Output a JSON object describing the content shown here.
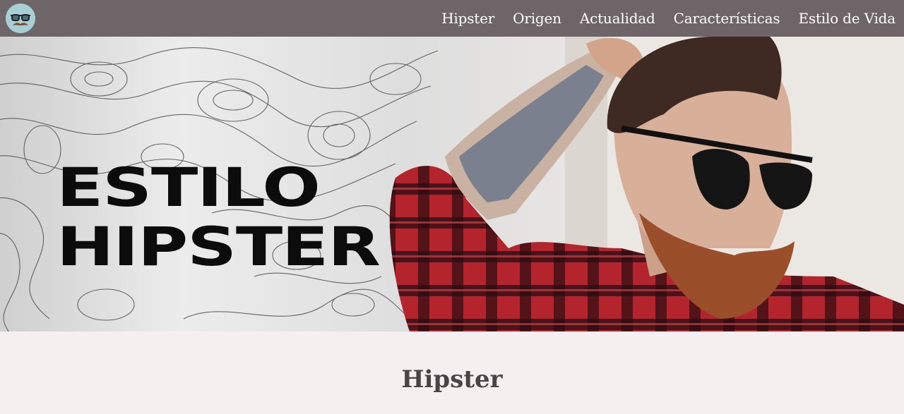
{
  "navbar": {
    "logo_icon": "hipster-glasses-mustache-icon",
    "links": [
      "Hipster",
      "Origen",
      "Actualidad",
      "Características",
      "Estilo de Vida"
    ]
  },
  "hero": {
    "title_line1": "ESTILO",
    "title_line2": "HIPSTER",
    "image": "man-with-beard-sunglasses-plaid-shirt-tattoo"
  },
  "section": {
    "title": "Hipster"
  },
  "colors": {
    "navbar": "#6e6569",
    "page_bg": "#f5efef",
    "heading": "#4a4446",
    "plaid_red": "#b4242c"
  }
}
